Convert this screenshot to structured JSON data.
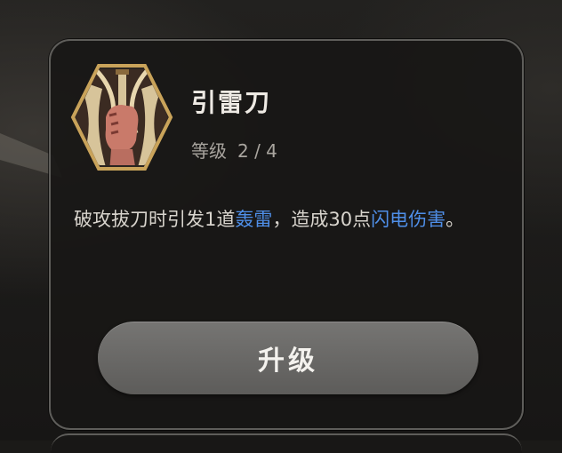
{
  "skill": {
    "name": "引雷刀",
    "level_label": "等级",
    "level_value": "2 / 4",
    "icon": "raised-blade-fist-icon"
  },
  "description": {
    "part1": "破攻拔刀时引发1道",
    "highlight1": "轰雷",
    "part2": "，造成30点",
    "highlight2": "闪电伤害",
    "part3": "。"
  },
  "actions": {
    "upgrade_label": "升级"
  },
  "colors": {
    "highlight": "#4f8fe8",
    "icon_gold": "#c9a35a",
    "panel_border": "#5e5d5a",
    "button": "#6a6967"
  }
}
